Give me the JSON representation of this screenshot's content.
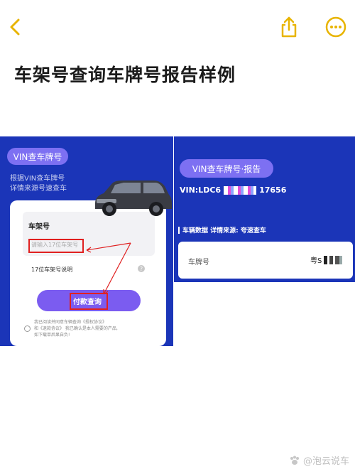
{
  "header": {
    "back_icon": "chevron-left-icon",
    "share_icon": "share-icon",
    "more_icon": "more-dots-icon",
    "accent": "#e8b400"
  },
  "title": "车架号查询车牌号报告样例",
  "left_screen": {
    "tag": "VIN查车牌号",
    "desc_line1": "根据VIN查车牌号",
    "desc_line2": "详情来源号速查车",
    "field_label": "车架号",
    "field_placeholder": "请输入17位车架号",
    "help_label": "17位车架号说明",
    "help_icon": "question-icon",
    "pay_button": "付款查询",
    "agreement_line1": "我已阅读并同意车辆查询《授权协议》",
    "agreement_line2": "和《退款协议》 我已确认是本人需要的产品,",
    "agreement_line3": "如下载单后果自负!"
  },
  "right_screen": {
    "tag": "VIN查车牌号·报告",
    "vin_prefix": "VIN:LDC6",
    "vin_suffix": "17656",
    "source_line": "车辆数据 详情来源: 夸速查车",
    "plate_label": "车牌号",
    "plate_value": "粤S"
  },
  "watermark": "@泡云说车",
  "colors": {
    "panel_blue": "#1b35b8",
    "pill_purple": "#7d70f2",
    "annotation_red": "#e02020"
  }
}
